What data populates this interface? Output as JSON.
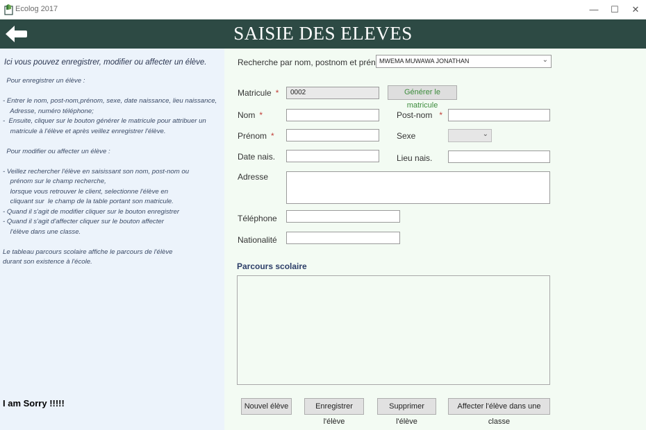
{
  "window": {
    "app_title": "Ecolog  2017",
    "minimize": "—",
    "maximize": "☐",
    "close": "✕"
  },
  "header": {
    "title": "SAISIE DES ELEVES",
    "back_icon": "arrow-left-icon"
  },
  "help": {
    "intro": "Ici vous pouvez enregistrer, modifier ou affecter un élève.",
    "body": "  Pour enregistrer un élève :\n\n- Entrer le nom, post-nom,prénom, sexe, date naissance, lieu naissance,\n    Adresse, numéro téléphone;\n-  Ensuite, cliquer sur le bouton générer le matricule pour attribuer un\n    matricule à l'élève et après veillez enregistrer l'élève.\n\n  Pour modifier ou affecter un élève :\n\n- Veillez rechercher l'élève en saisissant son nom, post-nom ou\n    prénom sur le champ recherche,\n    lorsque vous retrouver le client, selectionne l'élève en\n    cliquant sur  le champ de la table portant son matricule.\n- Quand il s'agit de modifier cliquer sur le bouton enregistrer\n- Quand il s'agit d'affecter cliquer sur le bouton affecter\n    l'élève dans une classe.\n\nLe tableau parcours scolaire affiche le parcours de l'élève\ndurant son existence à l'école.",
    "sorry": "I am Sorry !!!!!"
  },
  "form": {
    "search_label": "Recherche par nom, postnom et prénom",
    "search_value": "MWEMA MUWAWA JONATHAN",
    "required_mark": "*",
    "matricule_label": "Matricule",
    "matricule_value": "0002",
    "generate_button": "Générer le matricule",
    "nom_label": "Nom",
    "postnom_label": "Post-nom",
    "prenom_label": "Prénom",
    "sexe_label": "Sexe",
    "date_label": "Date nais.",
    "lieu_label": "Lieu nais.",
    "adresse_label": "Adresse",
    "telephone_label": "Téléphone",
    "nationalite_label": "Nationalité",
    "parcours_title": "Parcours scolaire"
  },
  "buttons": {
    "nouvel": "Nouvel élève",
    "enregistrer": "Enregistrer l'élève",
    "supprimer": "Supprimer l'élève",
    "affecter": "Affecter l'élève dans une classe"
  },
  "colors": {
    "header_bg": "#2d4a44",
    "help_bg": "#ecf3fb",
    "form_bg": "#f3fbf3",
    "required": "#c2403a",
    "generate_text": "#3c8c3c"
  }
}
